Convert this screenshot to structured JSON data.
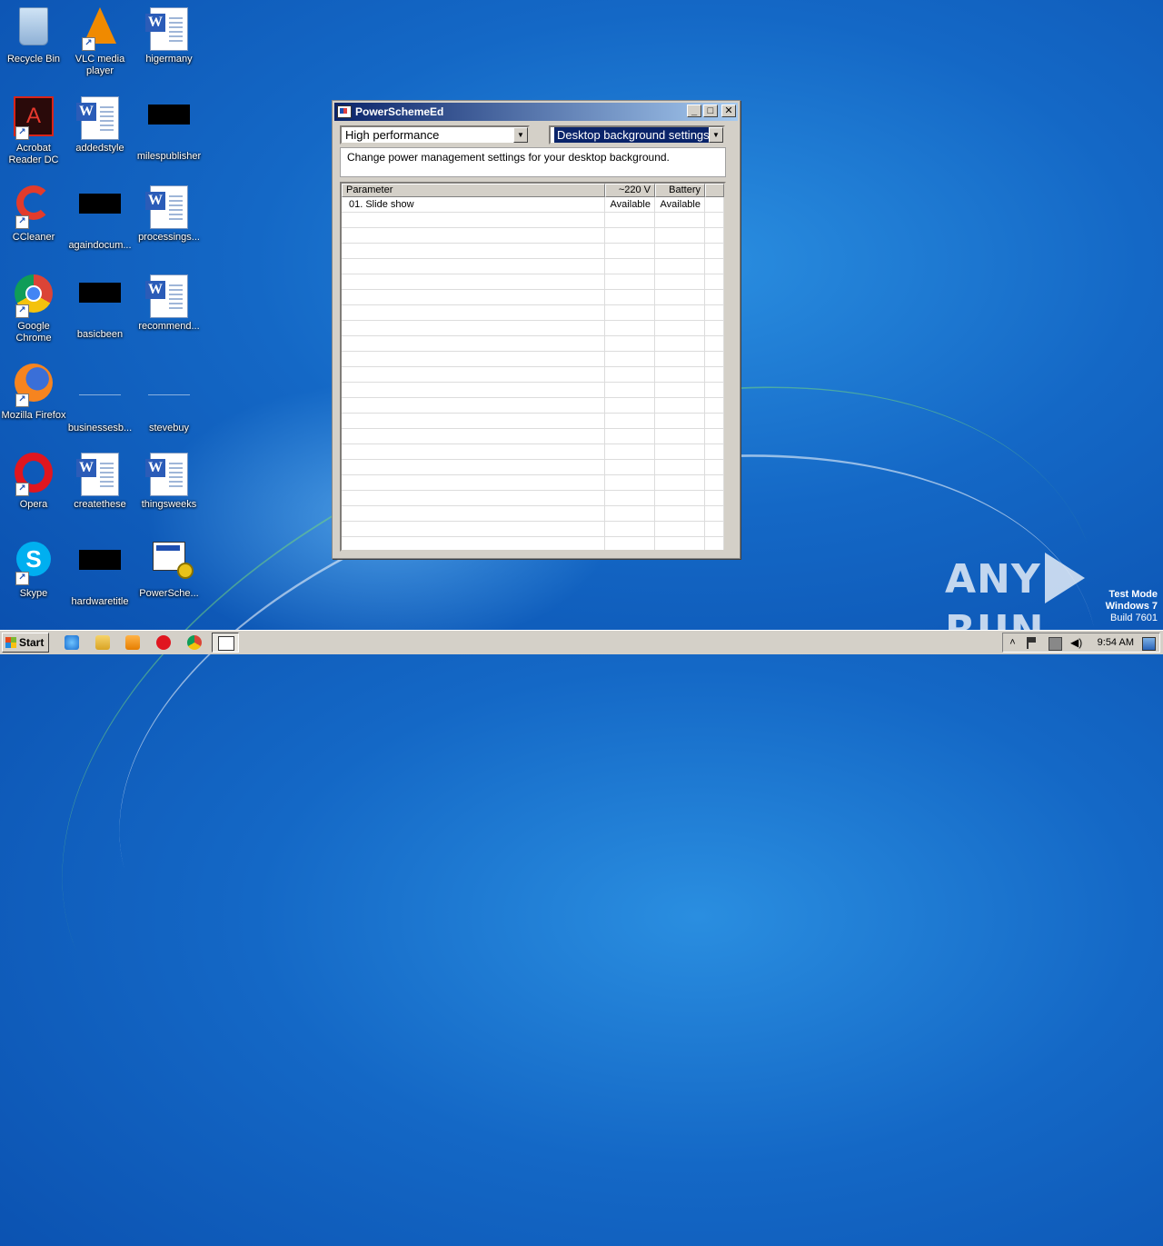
{
  "desktop": {
    "icons": [
      {
        "label": "Recycle Bin"
      },
      {
        "label": "VLC media player"
      },
      {
        "label": "higermany"
      },
      {
        "label": "Acrobat Reader DC"
      },
      {
        "label": "addedstyle"
      },
      {
        "label": "milespublisher"
      },
      {
        "label": "CCleaner"
      },
      {
        "label": "againdocum..."
      },
      {
        "label": "processings..."
      },
      {
        "label": "Google Chrome"
      },
      {
        "label": "basicbeen"
      },
      {
        "label": "recommend..."
      },
      {
        "label": "Mozilla Firefox"
      },
      {
        "label": "businessesb..."
      },
      {
        "label": "stevebuy"
      },
      {
        "label": "Opera"
      },
      {
        "label": "createthese"
      },
      {
        "label": "thingsweeks"
      },
      {
        "label": "Skype"
      },
      {
        "label": "hardwaretitle"
      },
      {
        "label": "PowerSche..."
      }
    ]
  },
  "window": {
    "title": "PowerSchemeEd",
    "minimize": "_",
    "maximize": "□",
    "close": "✕",
    "scheme_select": "High performance",
    "setting_select": "Desktop background settings",
    "description": "Change power management settings for your desktop background.",
    "grid": {
      "headers": [
        "Parameter",
        "~220 V",
        "Battery"
      ],
      "rows": [
        [
          "01. Slide show",
          "Available",
          "Available"
        ]
      ]
    }
  },
  "watermark": {
    "text_left": "ANY",
    "text_right": "RUN"
  },
  "testmode": {
    "line1": "Test Mode",
    "line2": "Windows 7",
    "line3": "Build 7601"
  },
  "taskbar": {
    "start_label": "Start",
    "clock": "9:54 AM"
  }
}
